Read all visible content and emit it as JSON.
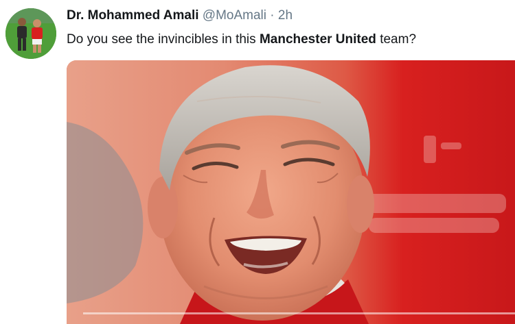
{
  "tweet": {
    "author_name": "Dr. Mohammed Amali",
    "handle": "@MoAmali",
    "separator": "·",
    "time": "2h",
    "text_before": "Do you see the invincibles in this ",
    "text_bold": "Manchester United",
    "text_after": " team?"
  },
  "media": {
    "kind": "video",
    "progress": 0
  },
  "colors": {
    "name": "#14171a",
    "muted": "#657786",
    "shirt_red": "#d8201f",
    "background_salmon": "#e0856f"
  }
}
